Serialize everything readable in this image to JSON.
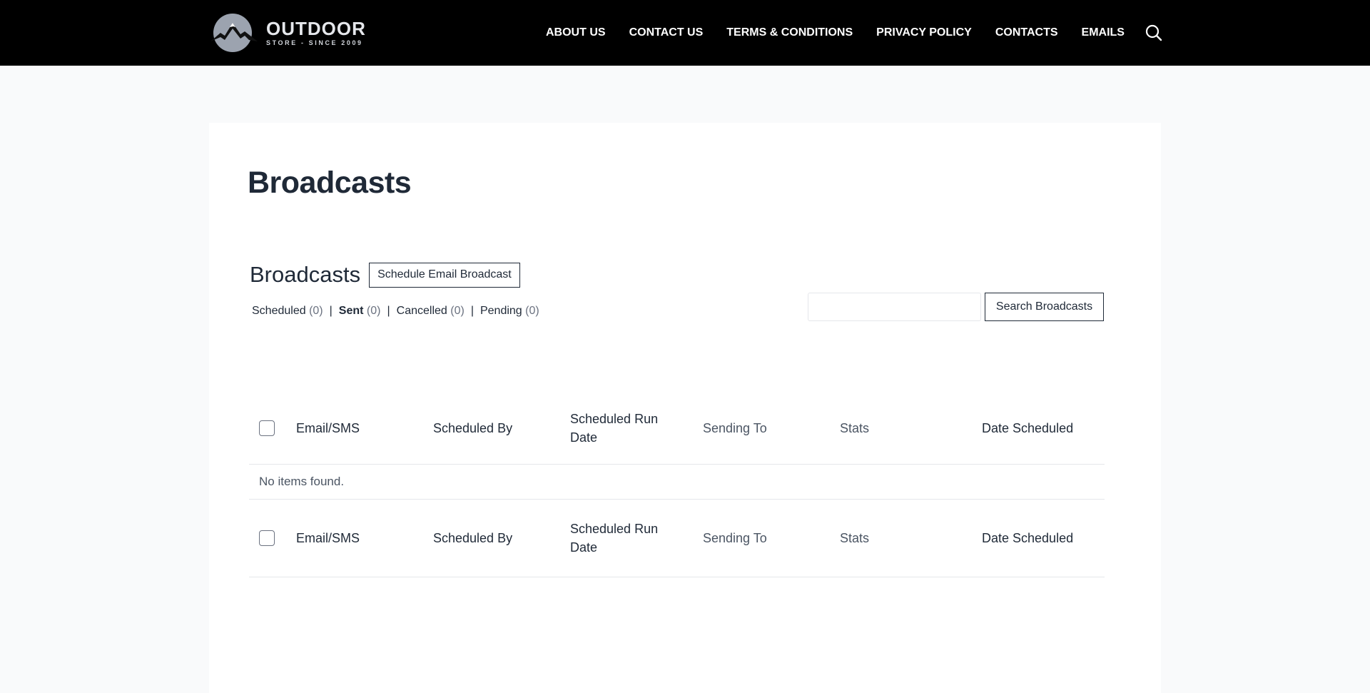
{
  "header": {
    "logo": {
      "title": "OUTDOOR",
      "subtitle": "STORE - SINCE 2009"
    },
    "nav": [
      "ABOUT US",
      "CONTACT US",
      "TERMS & CONDITIONS",
      "PRIVACY POLICY",
      "CONTACTS",
      "EMAILS"
    ],
    "search_icon": "search-icon"
  },
  "page": {
    "title": "Broadcasts"
  },
  "broadcasts": {
    "section_title": "Broadcasts",
    "schedule_button": "Schedule Email Broadcast",
    "filters": [
      {
        "label": "Scheduled",
        "count": "(0)",
        "current": false
      },
      {
        "label": "Sent",
        "count": "(0)",
        "current": true
      },
      {
        "label": "Cancelled",
        "count": "(0)",
        "current": false
      },
      {
        "label": "Pending",
        "count": "(0)",
        "current": false
      }
    ],
    "search": {
      "value": "",
      "button": "Search Broadcasts"
    }
  },
  "table": {
    "columns": [
      "Email/SMS",
      "Scheduled By",
      "Scheduled Run Date",
      "Sending To",
      "Stats",
      "Date Scheduled"
    ],
    "empty_message": "No items found."
  }
}
